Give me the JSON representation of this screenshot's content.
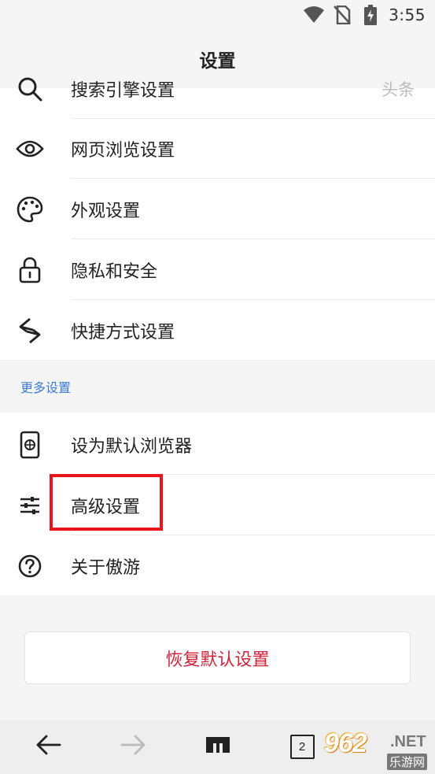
{
  "status_bar": {
    "time": "3:55",
    "icons": [
      "wifi-icon",
      "no-sim-icon",
      "battery-charging-icon"
    ]
  },
  "title_bar": {
    "title": "设置"
  },
  "settings_list": {
    "items": [
      {
        "label": "搜索引擎设置",
        "value": "头条",
        "icon": "search-icon"
      },
      {
        "label": "网页浏览设置",
        "icon": "eye-icon"
      },
      {
        "label": "外观设置",
        "icon": "palette-icon"
      },
      {
        "label": "隐私和安全",
        "icon": "lock-icon"
      },
      {
        "label": "快捷方式设置",
        "icon": "shortcut-icon"
      }
    ]
  },
  "more_section": {
    "header": "更多设置",
    "items": [
      {
        "label": "设为默认浏览器",
        "icon": "default-browser-icon"
      },
      {
        "label": "高级设置",
        "icon": "sliders-icon"
      },
      {
        "label": "关于傲游",
        "icon": "help-icon"
      }
    ]
  },
  "reset_button": {
    "label": "恢复默认设置"
  },
  "bottom_nav": {
    "tab_count": "2",
    "icons": [
      "back-arrow-icon",
      "forward-arrow-icon",
      "home-icon",
      "tabs-icon"
    ]
  },
  "watermark": {
    "main": "962",
    "net": ".NET",
    "sub": "乐游网"
  },
  "colors": {
    "accent_blue": "#3a7bd5",
    "reset_red": "#d0233a",
    "highlight_red": "#e8161c",
    "background": "#f5f5f5"
  }
}
